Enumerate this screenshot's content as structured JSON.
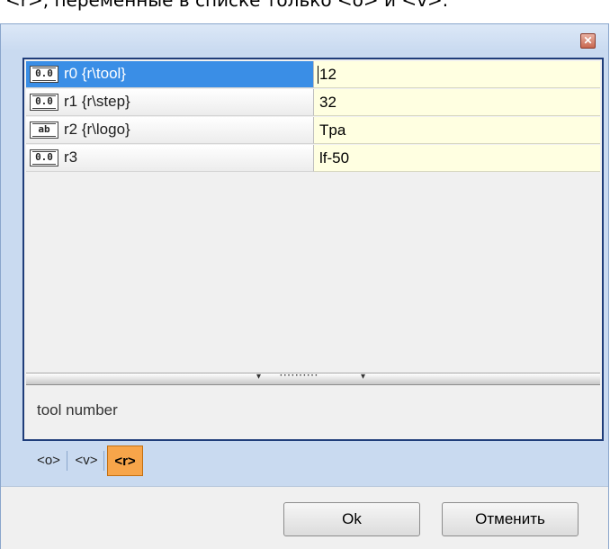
{
  "top_text": "<r>, переменные в списке только <o> и <v>.",
  "window": {
    "close_symbol": "✕"
  },
  "rows": [
    {
      "icon": "0.0",
      "label": "r0 {r\\tool}",
      "value": "12",
      "selected": true
    },
    {
      "icon": "0.0",
      "label": "r1 {r\\step}",
      "value": "32",
      "selected": false
    },
    {
      "icon": "ab",
      "label": "r2 {r\\logo}",
      "value": "Tpa",
      "selected": false
    },
    {
      "icon": "0.0",
      "label": "r3",
      "value": "lf-50",
      "selected": false
    }
  ],
  "splitter": {
    "left_arrow": "▾",
    "dots": "··········",
    "right_arrow": "▾"
  },
  "description": "tool number",
  "tabs": [
    {
      "label": "<o>",
      "active": false
    },
    {
      "label": "<v>",
      "active": false
    },
    {
      "label": "<r>",
      "active": true
    }
  ],
  "buttons": {
    "ok": "Ok",
    "cancel": "Отменить"
  },
  "colors": {
    "selected_row": "#3a8ee6",
    "value_bg": "#ffffe1",
    "active_tab": "#f7a54a",
    "panel_border": "#1f3d7a"
  }
}
